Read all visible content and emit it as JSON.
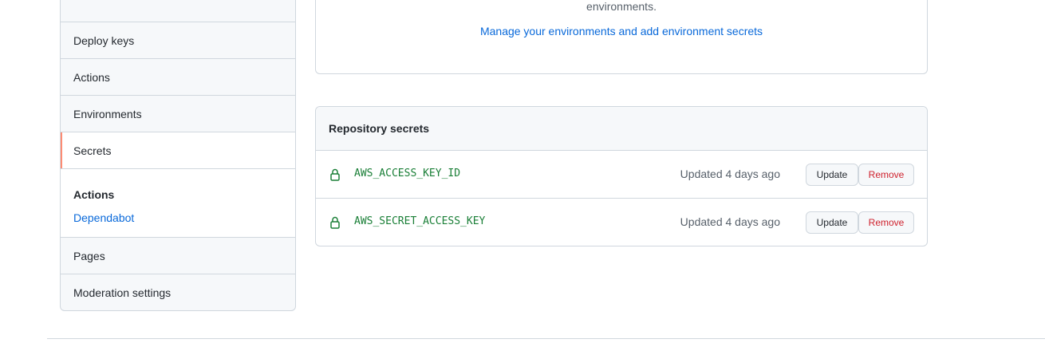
{
  "sidebar": {
    "items_top": [
      {
        "label": "Deploy keys"
      },
      {
        "label": "Actions"
      },
      {
        "label": "Environments"
      },
      {
        "label": "Secrets"
      }
    ],
    "group": {
      "title": "Actions",
      "link": "Dependabot"
    },
    "items_bottom": [
      {
        "label": "Pages"
      },
      {
        "label": "Moderation settings"
      }
    ]
  },
  "environments": {
    "text": "environments.",
    "link": "Manage your environments and add environment secrets"
  },
  "secrets": {
    "title": "Repository secrets",
    "rows": [
      {
        "name": "AWS_ACCESS_KEY_ID",
        "updated": "Updated 4 days ago",
        "update_label": "Update",
        "remove_label": "Remove"
      },
      {
        "name": "AWS_SECRET_ACCESS_KEY",
        "updated": "Updated 4 days ago",
        "update_label": "Update",
        "remove_label": "Remove"
      }
    ]
  },
  "colors": {
    "accent": "#0969da",
    "selected_marker": "#fd8c73",
    "secret_green": "#1a7f37",
    "danger": "#cf222e"
  }
}
